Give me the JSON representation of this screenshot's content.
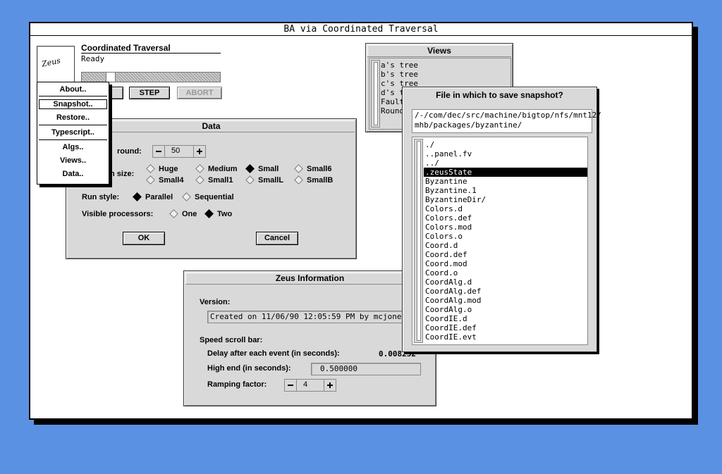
{
  "window": {
    "title": "BA via Coordinated Traversal"
  },
  "main": {
    "logo_text": "Zeus",
    "alg_name": "Coordinated Traversal",
    "status": "Ready",
    "buttons": {
      "step": "STEP",
      "abort": "ABORT"
    }
  },
  "menu": {
    "items": [
      "About..",
      "Snapshot..",
      "Restore..",
      "Typescript..",
      "Algs..",
      "Views..",
      "Data.."
    ]
  },
  "data_dialog": {
    "title": "Data",
    "round_label": "round:",
    "round_value": "50",
    "size_label": "n size:",
    "size_options": [
      "Huge",
      "Medium",
      "Small",
      "Small6",
      "Small4",
      "Small1",
      "SmallL",
      "SmallB"
    ],
    "size_selected": "Small",
    "run_style_label": "Run style:",
    "run_style_options": [
      "Parallel",
      "Sequential"
    ],
    "run_style_selected": "Parallel",
    "visible_label": "Visible processors:",
    "visible_options": [
      "One",
      "Two"
    ],
    "visible_selected": "Two",
    "ok": "OK",
    "cancel": "Cancel"
  },
  "views": {
    "title": "Views",
    "items": [
      "a's tree",
      "b's tree",
      "c's tree",
      "d's t",
      "Fault",
      "Round"
    ]
  },
  "snapshot": {
    "title": "File in which to save snapshot?",
    "path": "/-/com/dec/src/machine/bigtop/nfs/mnt12/\nmhb/packages/byzantine/",
    "files": [
      "./",
      "..panel.fv",
      "../",
      ".zeusState",
      "Byzantine",
      "Byzantine.1",
      "ByzantineDir/",
      "Colors.d",
      "Colors.def",
      "Colors.mod",
      "Colors.o",
      "Coord.d",
      "Coord.def",
      "Coord.mod",
      "Coord.o",
      "CoordAlg.d",
      "CoordAlg.def",
      "CoordAlg.mod",
      "CoordAlg.o",
      "CoordIE.d",
      "CoordIE.def",
      "CoordIE.evt"
    ],
    "selected": ".zeusState"
  },
  "info": {
    "title": "Zeus Information",
    "version_label": "Version:",
    "version_value": "Created on 11/06/90 12:05:59 PM by mcjones",
    "speed_label": "Speed scroll bar:",
    "delay_label": "Delay after each event (in seconds):",
    "delay_value": "0.008232",
    "highend_label": "High end (in seconds):",
    "highend_value": "0.500000",
    "ramp_label": "Ramping factor:",
    "ramp_value": "4"
  }
}
